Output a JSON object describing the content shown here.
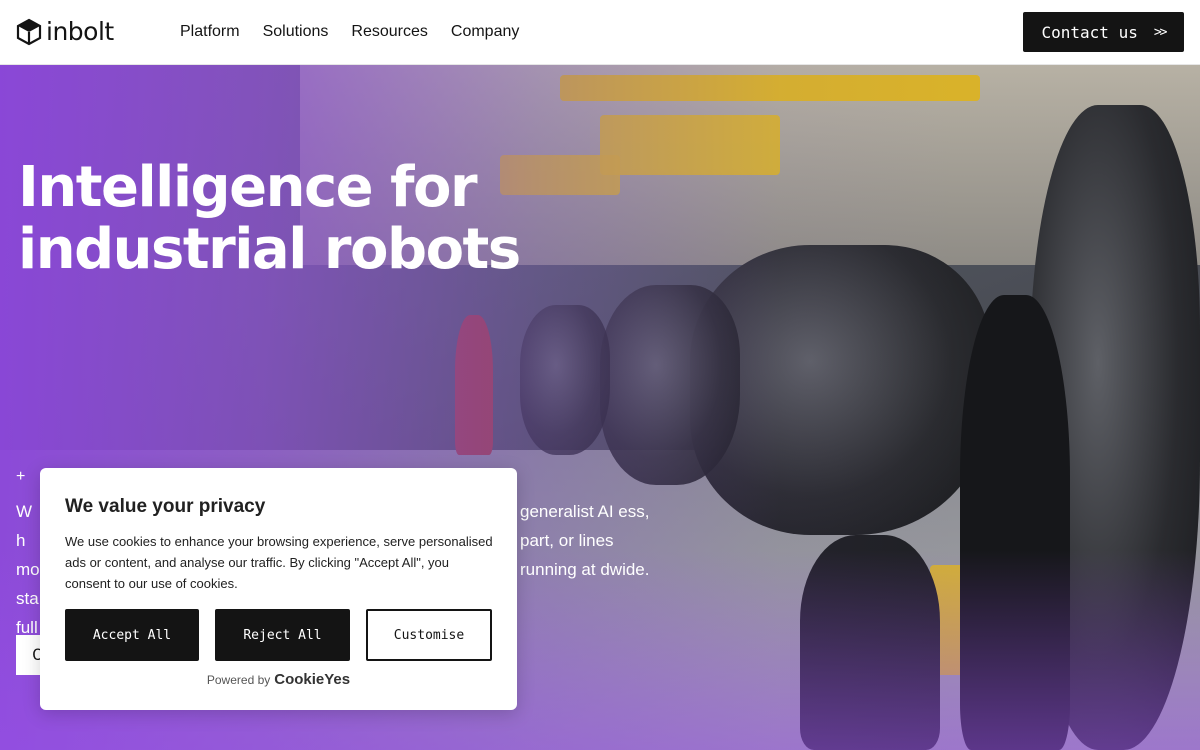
{
  "header": {
    "logo_text": "inbolt",
    "nav": [
      "Platform",
      "Solutions",
      "Resources",
      "Company"
    ],
    "contact_label": "Contact us",
    "contact_arrow": ">>"
  },
  "hero": {
    "title": "Intelligence for industrial robots",
    "plus": "+",
    "desc_left": "Wh mo sta full",
    "desc_right": "generalist AI ess, part, or lines running at dwide.",
    "cta_label": "C"
  },
  "cookie": {
    "title": "We value your privacy",
    "text": "We use cookies to enhance your browsing experience, serve personalised ads or content, and analyse our traffic. By clicking \"Accept All\", you consent to our use of cookies.",
    "accept_label": "Accept All",
    "reject_label": "Reject All",
    "customise_label": "Customise",
    "powered_by": "Powered by",
    "powered_brand": "CookieYes"
  }
}
